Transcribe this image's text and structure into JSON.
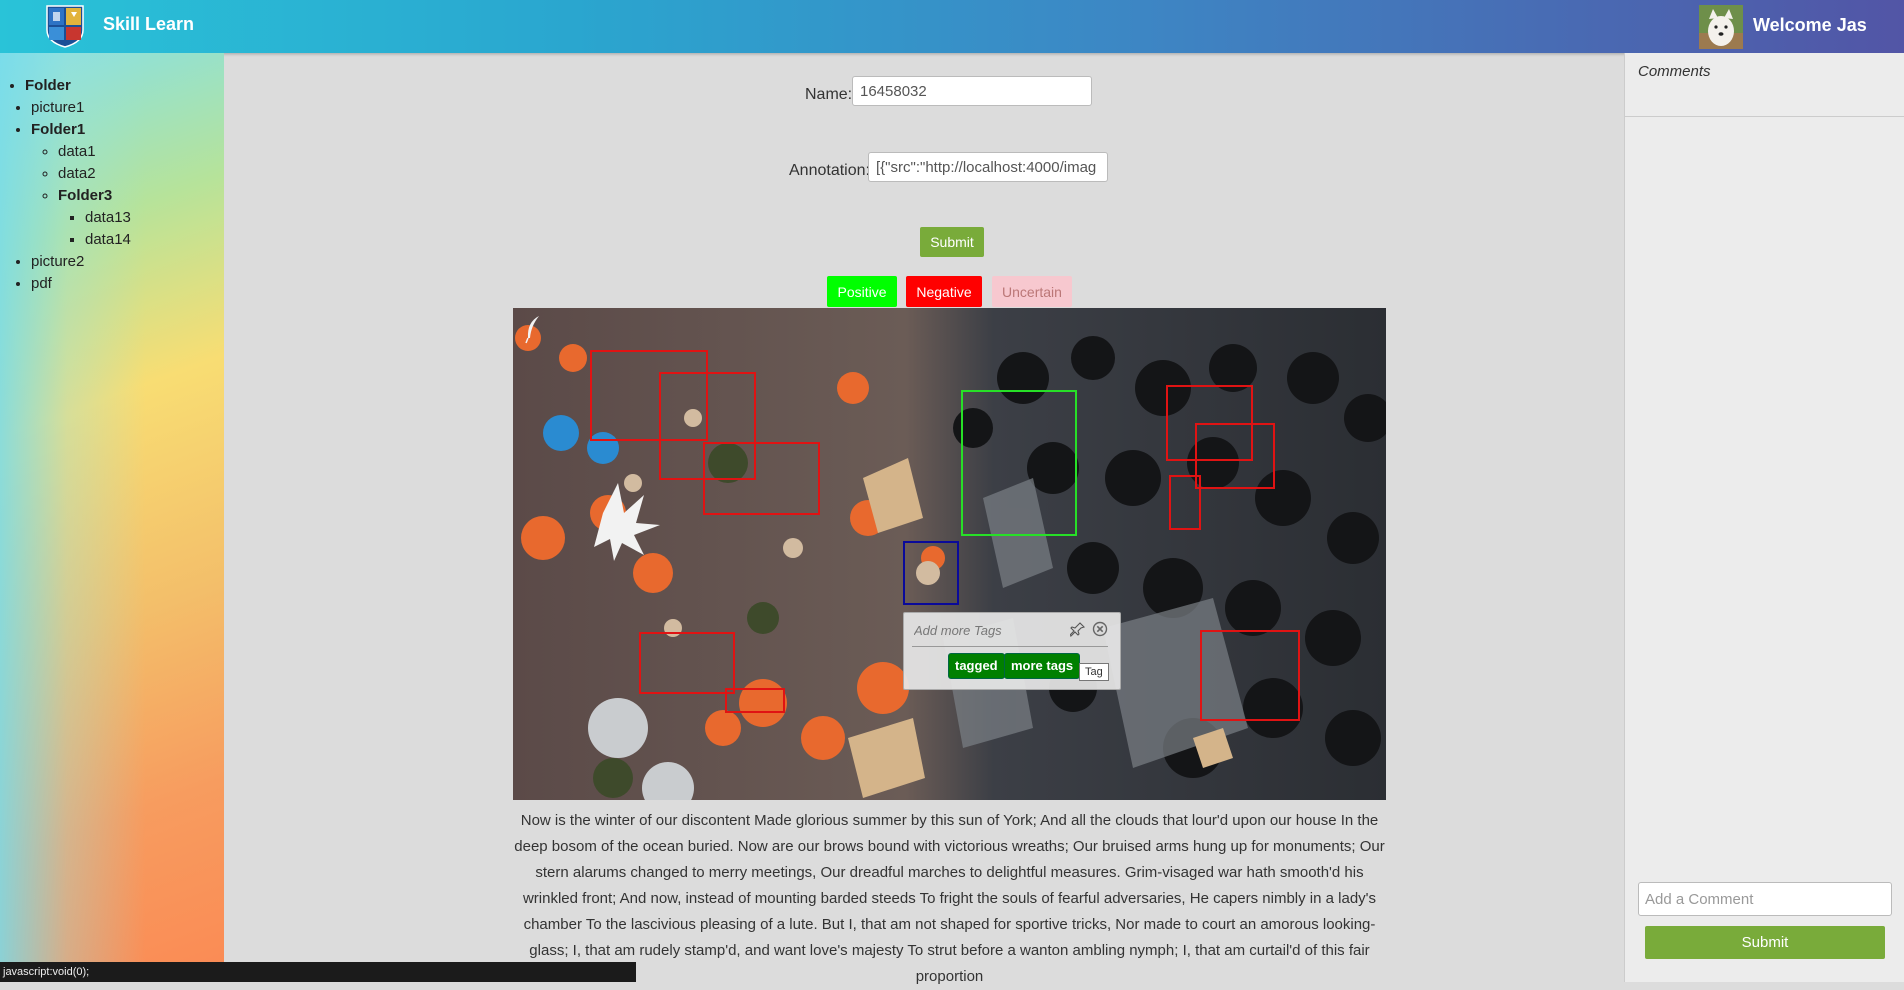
{
  "header": {
    "brand": "Skill Learn",
    "welcome": "Welcome Jas",
    "colors": {
      "from": "#29c3d8",
      "to": "#5255a6"
    }
  },
  "sidebar": {
    "tree": [
      {
        "label": "Folder",
        "type": "folder"
      },
      {
        "label": "picture1",
        "type": "file"
      },
      {
        "label": "Folder1",
        "type": "folder"
      },
      {
        "label": "data1",
        "type": "file"
      },
      {
        "label": "data2",
        "type": "file"
      },
      {
        "label": "Folder3",
        "type": "folder"
      },
      {
        "label": "data13",
        "type": "file"
      },
      {
        "label": "data14",
        "type": "file"
      },
      {
        "label": "picture2",
        "type": "file"
      },
      {
        "label": "pdf",
        "type": "file"
      }
    ]
  },
  "form": {
    "name_label": "Name:",
    "name_value": "16458032",
    "annotation_label": "Annotation:",
    "annotation_value": "[{\"src\":\"http://localhost:4000/imag",
    "submit_label": "Submit"
  },
  "sentiment": {
    "positive": "Positive",
    "negative": "Negative",
    "uncertain": "Uncertain",
    "colors": {
      "positive": "#00ff00",
      "negative": "#ff0000",
      "uncertain": "#f7c8cf"
    }
  },
  "annotation_popup": {
    "placeholder": "Add more Tags",
    "tags": [
      "tagged",
      "more tags"
    ],
    "tooltip": "Tag"
  },
  "description": "Now is the winter of our discontent Made glorious summer by this sun of York; And all the clouds that lour'd upon our house In the deep bosom of the ocean buried. Now are our brows bound with victorious wreaths; Our bruised arms hung up for monuments; Our stern alarums changed to merry meetings, Our dreadful marches to delightful measures. Grim-visaged war hath smooth'd his wrinkled front; And now, instead of mounting barded steeds To fright the souls of fearful adversaries, He capers nimbly in a lady's chamber To the lascivious pleasing of a lute. But I, that am not shaped for sportive tricks, Nor made to court an amorous looking-glass; I, that am rudely stamp'd, and want love's majesty To strut before a wanton ambling nymph; I, that am curtail'd of this fair proportion",
  "comments": {
    "title": "Comments",
    "placeholder": "Add a Comment",
    "submit_label": "Submit"
  },
  "statusbar": {
    "text": "javascript:void(0);"
  }
}
